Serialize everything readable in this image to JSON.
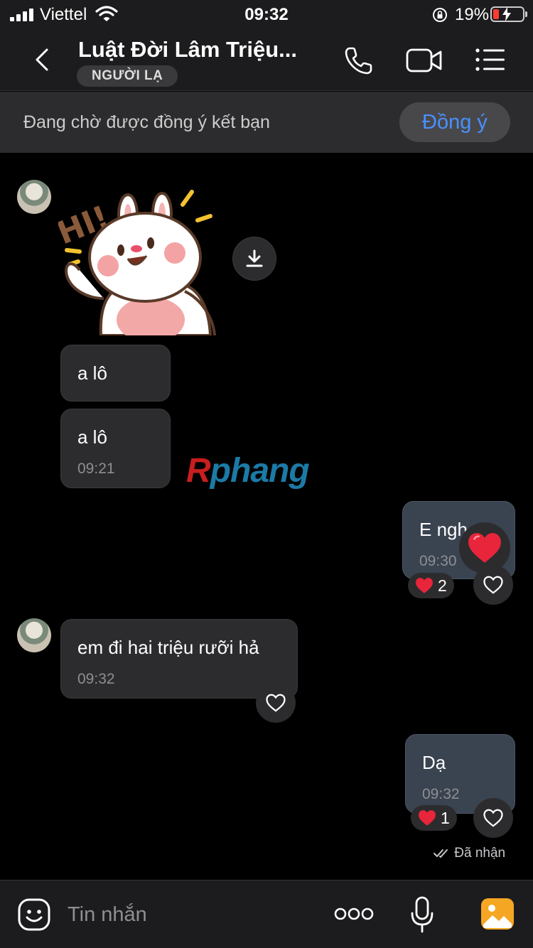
{
  "status_bar": {
    "carrier": "Viettel",
    "time": "09:32",
    "battery": "19%",
    "battery_level": 0.19
  },
  "header": {
    "title": "Luật Đời Lâm Triệu...",
    "badge": "NGƯỜI LẠ",
    "icons": [
      "back-icon",
      "phone-icon",
      "video-camera-icon",
      "list-menu-icon"
    ]
  },
  "friend_request": {
    "text": "Đang chờ được đồng ý kết bạn",
    "accept_label": "Đồng ý"
  },
  "messages": {
    "m1_text": "a lô",
    "m2_text": "a lô",
    "m2_time": "09:21",
    "m3_text": "E ngh",
    "m3_time": "09:30",
    "m3_reaction_count": "2",
    "m4_text": "em đi hai triệu rưỡi hả",
    "m4_time": "09:32",
    "m5_text": "Dạ",
    "m5_time": "09:32",
    "m5_reaction_count": "1",
    "received_status": "Đã nhận"
  },
  "sticker": {
    "text": "HI!"
  },
  "watermark": {
    "first": "R",
    "rest": "phang"
  },
  "input": {
    "placeholder": "Tin nhắn"
  },
  "colors": {
    "accent": "#4a90ff",
    "heart": "#e8253a",
    "background": "#000000",
    "incoming_bubble": "#2c2c2e",
    "outgoing_bubble": "#3a4350"
  }
}
